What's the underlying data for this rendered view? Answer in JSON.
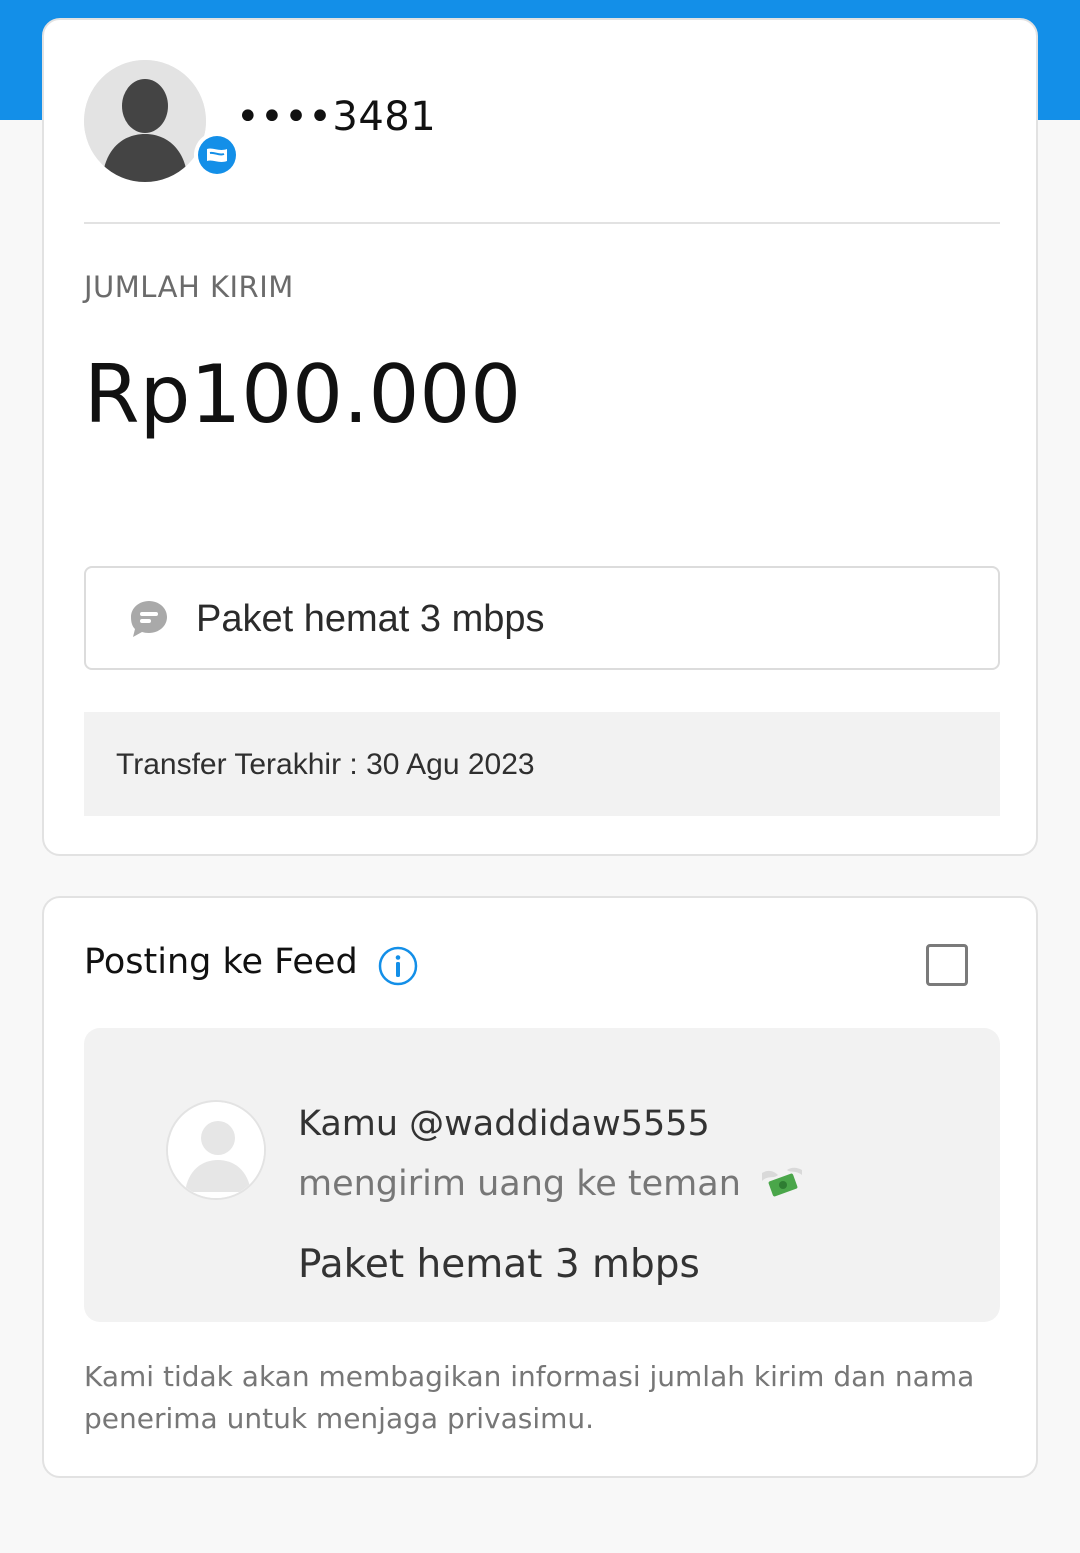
{
  "recipient": {
    "account_masked": "••••3481",
    "avatar_icon": "default-user-avatar",
    "badge_icon": "bank-transfer-badge-icon"
  },
  "amount": {
    "label": "JUMLAH KIRIM",
    "value": "Rp100.000"
  },
  "note": {
    "icon": "chat-bubble-icon",
    "text": "Paket hemat 3 mbps"
  },
  "last_transfer": {
    "text": "Transfer Terakhir : 30 Agu 2023"
  },
  "feed": {
    "title": "Posting ke Feed",
    "info_icon": "info-icon",
    "checked": false,
    "preview": {
      "name": "Kamu @waddidaw5555",
      "action": "mengirim uang ke teman",
      "action_icon": "flying-money-icon",
      "note": "Paket hemat 3 mbps"
    },
    "privacy_text": "Kami tidak akan membagikan informasi jumlah kirim dan nama penerima untuk menjaga privasimu."
  },
  "colors": {
    "brand_blue": "#138fe8",
    "card_bg": "#ffffff",
    "page_bg": "#f8f8f8",
    "muted_box": "#f2f2f2"
  }
}
